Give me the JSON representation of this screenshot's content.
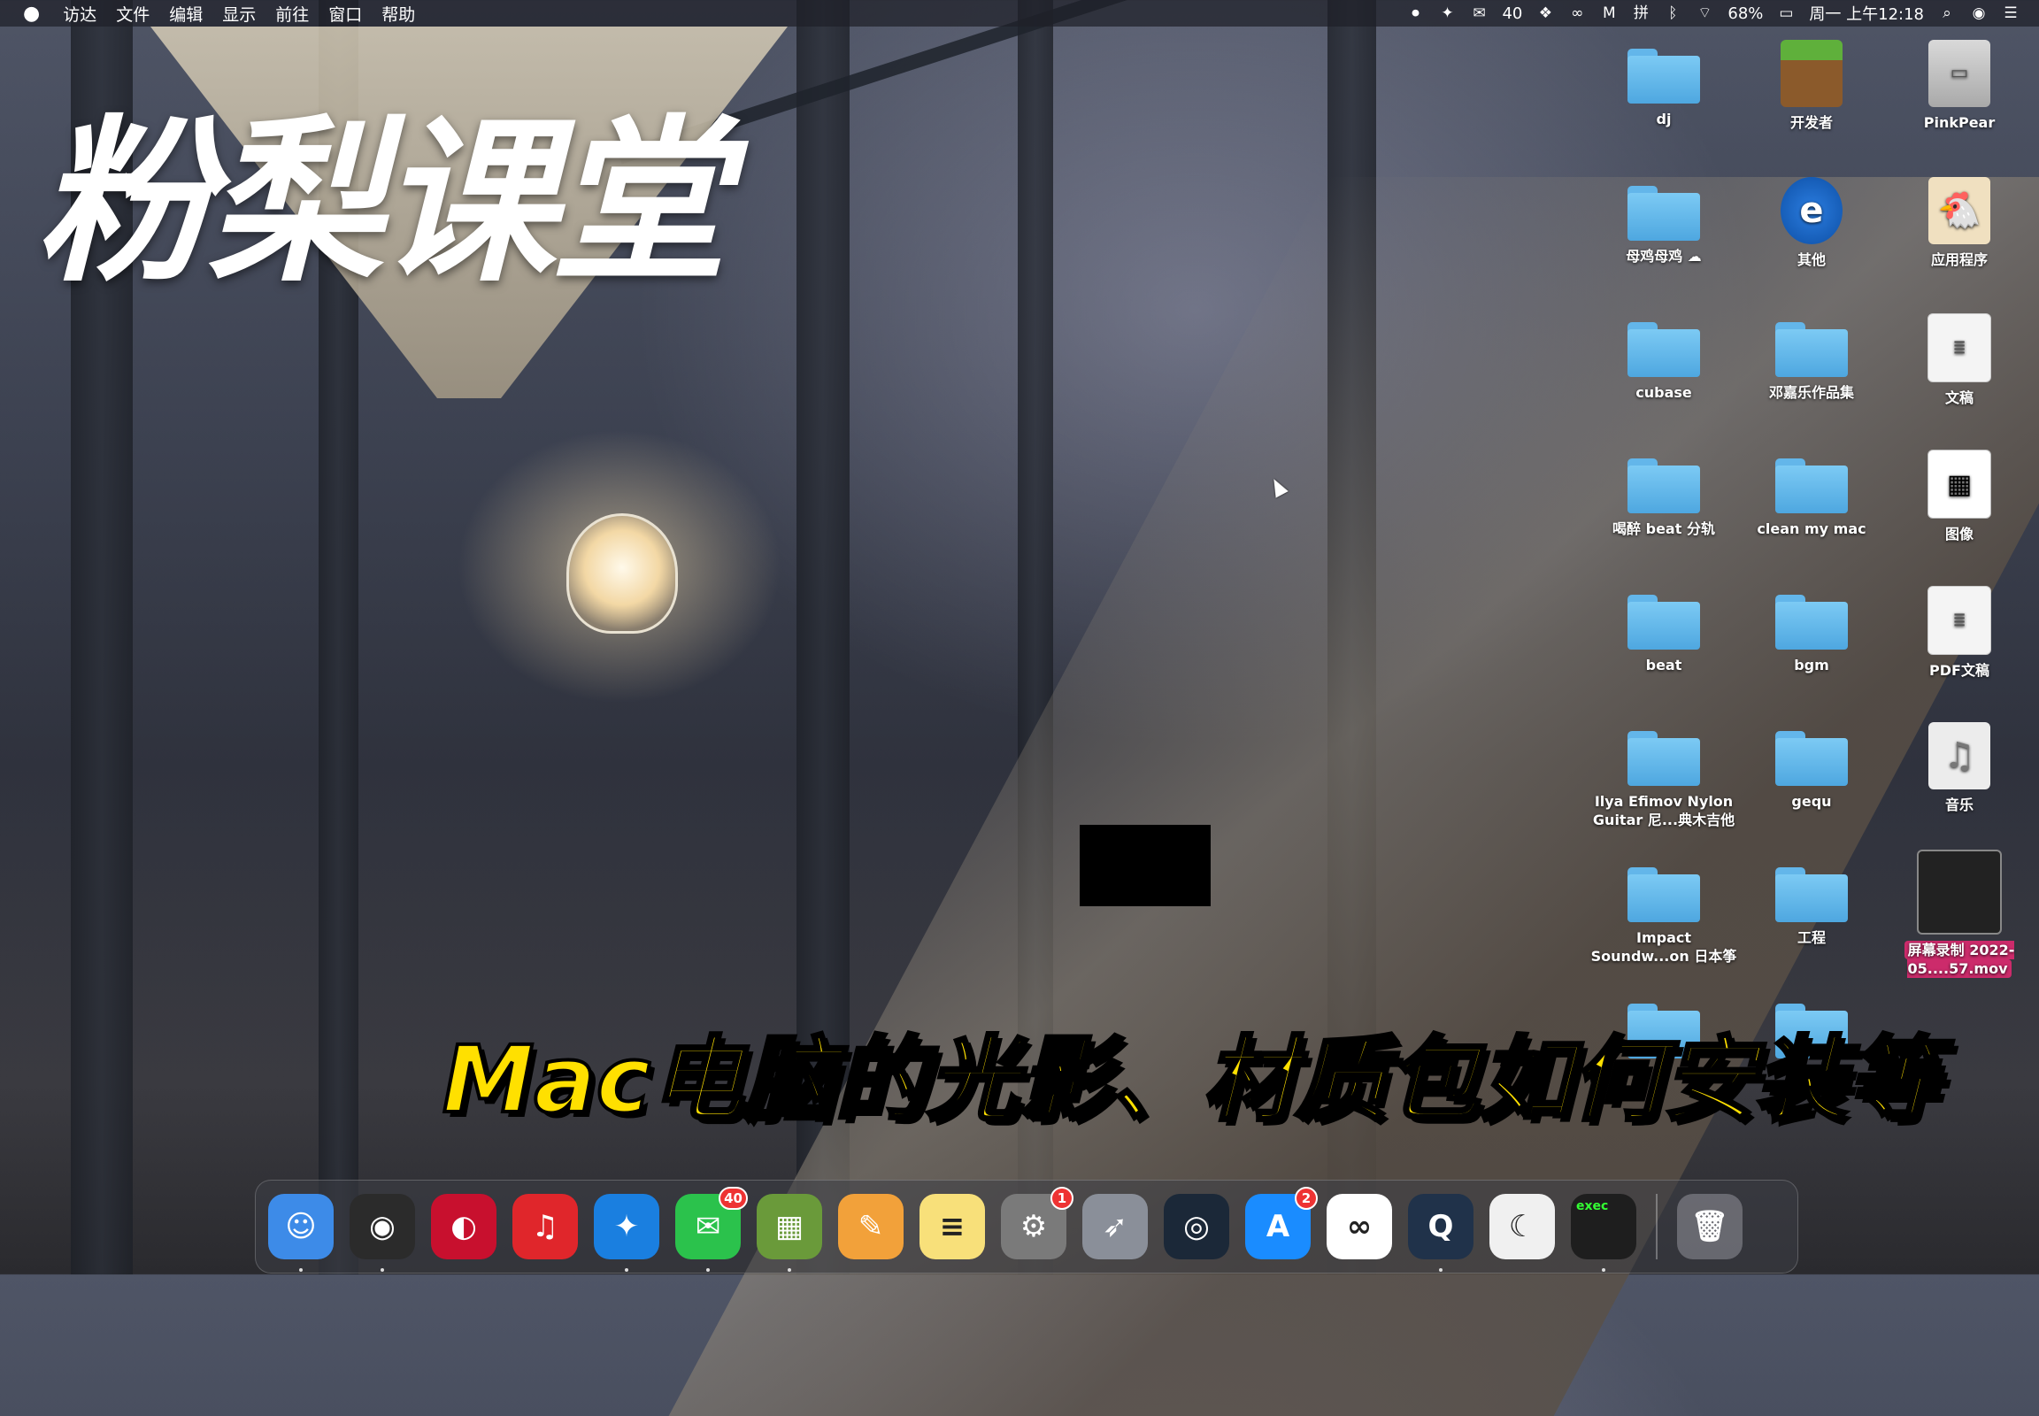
{
  "menubar": {
    "apple": "",
    "menus": [
      "访达",
      "文件",
      "编辑",
      "显示",
      "前往",
      "窗口",
      "帮助"
    ],
    "wechat_count": "40",
    "battery": "68%",
    "clock": "周一 上午12:18"
  },
  "overlay": {
    "title": "粉梨课堂",
    "subtitle": "Mac电脑的光影、材质包如何安装等"
  },
  "desktop": {
    "items": [
      {
        "label": "dj",
        "kind": "folder"
      },
      {
        "label": "开发者",
        "kind": "mc"
      },
      {
        "label": "PinkPear",
        "kind": "disk"
      },
      {
        "label": "母鸡母鸡",
        "kind": "folder"
      },
      {
        "label": "其他",
        "kind": "ie"
      },
      {
        "label": "应用程序",
        "kind": "chick"
      },
      {
        "label": "cubase",
        "kind": "folder"
      },
      {
        "label": "邓嘉乐作品集",
        "kind": "folder"
      },
      {
        "label": "文稿",
        "kind": "doc"
      },
      {
        "label": "喝醉 beat 分轨",
        "kind": "folder"
      },
      {
        "label": "clean my mac",
        "kind": "folder"
      },
      {
        "label": "图像",
        "kind": "qr"
      },
      {
        "label": "beat",
        "kind": "folder"
      },
      {
        "label": "bgm",
        "kind": "folder"
      },
      {
        "label": "PDF文稿",
        "kind": "doc"
      },
      {
        "label": "Ilya Efimov Nylon Guitar 尼...典木吉他",
        "kind": "folder"
      },
      {
        "label": "gequ",
        "kind": "folder"
      },
      {
        "label": "音乐",
        "kind": "music"
      },
      {
        "label": "Impact Soundw...on 日本筝",
        "kind": "folder"
      },
      {
        "label": "工程",
        "kind": "folder"
      },
      {
        "label": "屏幕录制 2022-05....57.mov",
        "kind": "video"
      }
    ]
  },
  "dock": {
    "apps": [
      {
        "name": "finder",
        "glyph": "☺",
        "color": "#3d8be8"
      },
      {
        "name": "dvd-player",
        "glyph": "◉",
        "color": "#2b2b2b"
      },
      {
        "name": "cubase",
        "glyph": "◐",
        "color": "#c8102e"
      },
      {
        "name": "netease-music",
        "glyph": "♫",
        "color": "#e0262b"
      },
      {
        "name": "safari",
        "glyph": "✦",
        "color": "#1a7fe0"
      },
      {
        "name": "wechat",
        "glyph": "✉",
        "color": "#2bc24c",
        "badge": "40"
      },
      {
        "name": "minecraft",
        "glyph": "▦",
        "color": "#6a9a3a"
      },
      {
        "name": "pages",
        "glyph": "✎",
        "color": "#f2a13a"
      },
      {
        "name": "notes",
        "glyph": "≡",
        "color": "#f8e07a"
      },
      {
        "name": "system-preferences",
        "glyph": "⚙",
        "color": "#7a7a7a",
        "badge": "1"
      },
      {
        "name": "launchpad",
        "glyph": "➶",
        "color": "#8a8f99"
      },
      {
        "name": "steam",
        "glyph": "◎",
        "color": "#1b2838"
      },
      {
        "name": "app-store",
        "glyph": "A",
        "color": "#1a8cff",
        "badge": "2"
      },
      {
        "name": "link-app",
        "glyph": "∞",
        "color": "#ffffff"
      },
      {
        "name": "quicktime",
        "glyph": "Q",
        "color": "#20324a"
      },
      {
        "name": "cat-app",
        "glyph": "☾",
        "color": "#f0f0f0"
      },
      {
        "name": "terminal",
        "glyph": "exec",
        "color": "#1e1e1e"
      }
    ],
    "trash": {
      "glyph": "🗑"
    }
  }
}
